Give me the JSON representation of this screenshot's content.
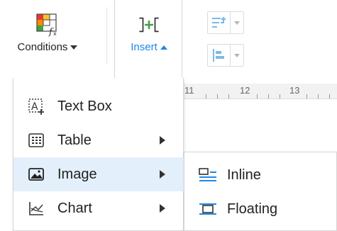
{
  "toolbar": {
    "conditions": {
      "label": "Conditions",
      "icon": "conditional-format-icon"
    },
    "insert": {
      "label": "Insert",
      "icon": "insert-columns-icon",
      "accent": "#1e88e5"
    },
    "right_buttons": [
      {
        "icon": "wrap-text-icon"
      },
      {
        "icon": "align-left-icon"
      }
    ]
  },
  "ruler": {
    "marks": [
      "11",
      "12",
      "13"
    ]
  },
  "insert_menu": {
    "items": [
      {
        "label": "Text Box",
        "icon": "text-box-icon",
        "has_submenu": false
      },
      {
        "label": "Table",
        "icon": "table-icon",
        "has_submenu": true
      },
      {
        "label": "Image",
        "icon": "image-icon",
        "has_submenu": true,
        "highlighted": true
      },
      {
        "label": "Chart",
        "icon": "chart-icon",
        "has_submenu": true
      }
    ],
    "highlight_color": "#e3f0fb"
  },
  "image_submenu": {
    "items": [
      {
        "label": "Inline",
        "icon": "inline-image-icon"
      },
      {
        "label": "Floating",
        "icon": "floating-image-icon"
      }
    ],
    "icon_color": "#1e88e5"
  }
}
